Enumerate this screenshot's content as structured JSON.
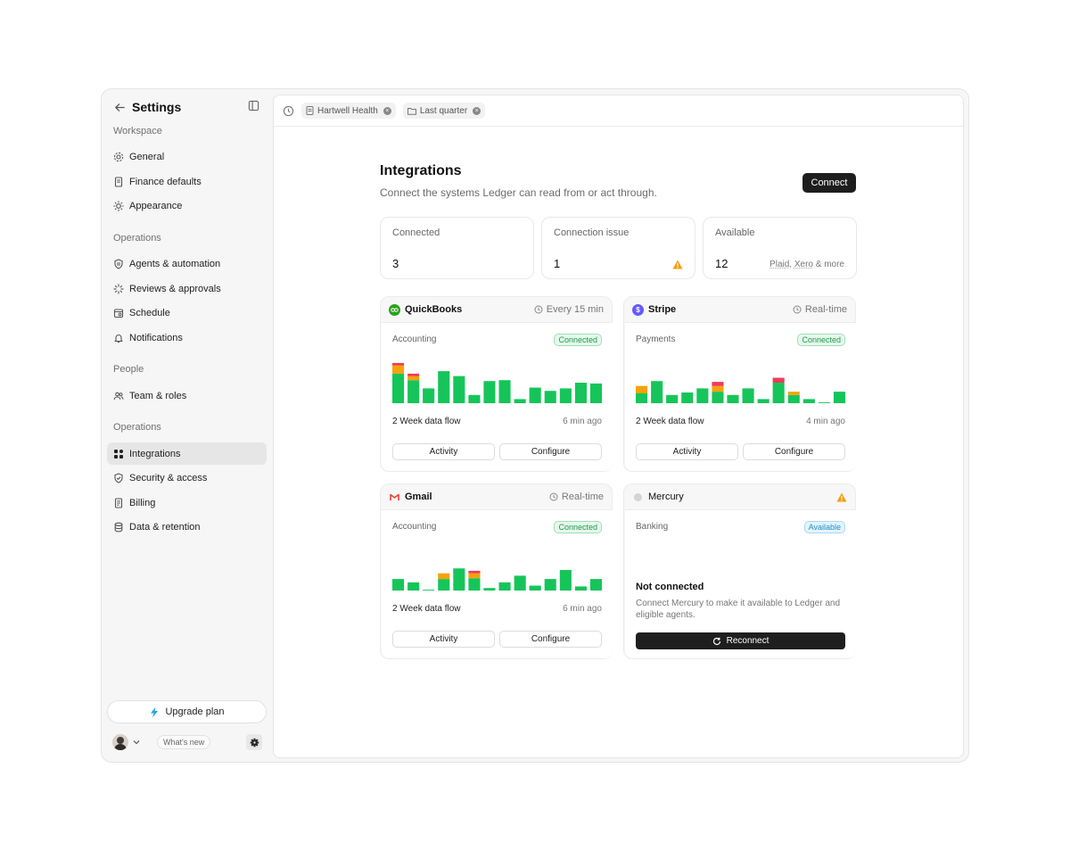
{
  "sidebar": {
    "title": "Settings",
    "sections": [
      {
        "label": "Workspace"
      },
      {
        "label": "Operations"
      },
      {
        "label": "People"
      },
      {
        "label": "Operations"
      }
    ],
    "items": [
      {
        "label": "General",
        "icon": "gear-icon"
      },
      {
        "label": "Finance defaults",
        "icon": "document-icon"
      },
      {
        "label": "Appearance",
        "icon": "sun-icon"
      },
      {
        "label": "Agents & automation",
        "icon": "shield-icon"
      },
      {
        "label": "Reviews & approvals",
        "icon": "spinner-icon"
      },
      {
        "label": "Schedule",
        "icon": "calendar-icon"
      },
      {
        "label": "Notifications",
        "icon": "bell-icon"
      },
      {
        "label": "Team & roles",
        "icon": "users-icon"
      },
      {
        "label": "Integrations",
        "icon": "grid-icon",
        "active": true
      },
      {
        "label": "Security & access",
        "icon": "shield-check-icon"
      },
      {
        "label": "Billing",
        "icon": "receipt-icon"
      },
      {
        "label": "Data & retention",
        "icon": "database-icon"
      }
    ],
    "upgrade_label": "Upgrade plan",
    "whats_new": "What's new"
  },
  "topbar": {
    "chips": [
      {
        "label": "Hartwell Health",
        "icon": "document-icon"
      },
      {
        "label": "Last quarter",
        "icon": "folder-icon"
      }
    ]
  },
  "page": {
    "title": "Integrations",
    "subtitle": "Connect the systems Ledger can read from or act through.",
    "connect_label": "Connect"
  },
  "stats": [
    {
      "label": "Connected",
      "value": "3"
    },
    {
      "label": "Connection issue",
      "value": "1",
      "warn": true
    },
    {
      "label": "Available",
      "value": "12",
      "extra_a": "Plaid",
      "extra_sep": ", ",
      "extra_b": "Xero",
      "extra_tail": " & more"
    }
  ],
  "colors": {
    "ok": "#16c55a",
    "warn": "#f5a20b",
    "error": "#ef3b5a"
  },
  "integrations": [
    {
      "name": "QuickBooks",
      "logo_color": "#2ca01c",
      "logo_text": "qb",
      "frequency": "Every 15 min",
      "category": "Accounting",
      "status": "Connected",
      "flow_label": "2 Week data flow",
      "updated": "6 min ago",
      "activity": "Activity",
      "configure": "Configure",
      "flow": [
        {
          "ok": 0.72,
          "warn": 0.2,
          "err": 0.06
        },
        {
          "ok": 0.56,
          "warn": 0.1,
          "err": 0.06
        },
        {
          "ok": 0.36
        },
        {
          "ok": 0.78
        },
        {
          "ok": 0.66
        },
        {
          "ok": 0.2
        },
        {
          "ok": 0.54
        },
        {
          "ok": 0.56
        },
        {
          "ok": 0.1
        },
        {
          "ok": 0.38
        },
        {
          "ok": 0.3
        },
        {
          "ok": 0.36
        },
        {
          "ok": 0.5
        },
        {
          "ok": 0.48
        }
      ]
    },
    {
      "name": "Stripe",
      "logo_color": "#635bff",
      "logo_text": "$",
      "frequency": "Real-time",
      "category": "Payments",
      "status": "Connected",
      "flow_label": "2 Week data flow",
      "updated": "4 min ago",
      "activity": "Activity",
      "configure": "Configure",
      "flow": [
        {
          "ok": 0.24,
          "warn": 0.18
        },
        {
          "ok": 0.54
        },
        {
          "ok": 0.2
        },
        {
          "ok": 0.26
        },
        {
          "ok": 0.36
        },
        {
          "ok": 0.28,
          "warn": 0.14,
          "err": 0.1
        },
        {
          "ok": 0.2
        },
        {
          "ok": 0.36
        },
        {
          "ok": 0.1
        },
        {
          "ok": 0.5,
          "err": 0.12
        },
        {
          "ok": 0.2,
          "warn": 0.08
        },
        {
          "ok": 0.1
        },
        {
          "ok": 0.02
        },
        {
          "ok": 0.28
        }
      ]
    },
    {
      "name": "Gmail",
      "logo_color": "#ffffff",
      "logo_text": "M",
      "frequency": "Real-time",
      "category": "Accounting",
      "status": "Connected",
      "flow_label": "2 Week data flow",
      "updated": "6 min ago",
      "activity": "Activity",
      "configure": "Configure",
      "flow": [
        {
          "ok": 0.28
        },
        {
          "ok": 0.2
        },
        {
          "ok": 0.02
        },
        {
          "ok": 0.28,
          "warn": 0.14
        },
        {
          "ok": 0.54
        },
        {
          "ok": 0.3,
          "warn": 0.12,
          "err": 0.06
        },
        {
          "ok": 0.06
        },
        {
          "ok": 0.2
        },
        {
          "ok": 0.36
        },
        {
          "ok": 0.12
        },
        {
          "ok": 0.28
        },
        {
          "ok": 0.5
        },
        {
          "ok": 0.1
        },
        {
          "ok": 0.28
        }
      ]
    },
    {
      "name": "Mercury",
      "category": "Banking",
      "status": "Available",
      "not_connected_title": "Not connected",
      "not_connected_desc": "Connect Mercury to make it available to Ledger and eligible agents.",
      "reconnect_label": "Reconnect"
    }
  ]
}
